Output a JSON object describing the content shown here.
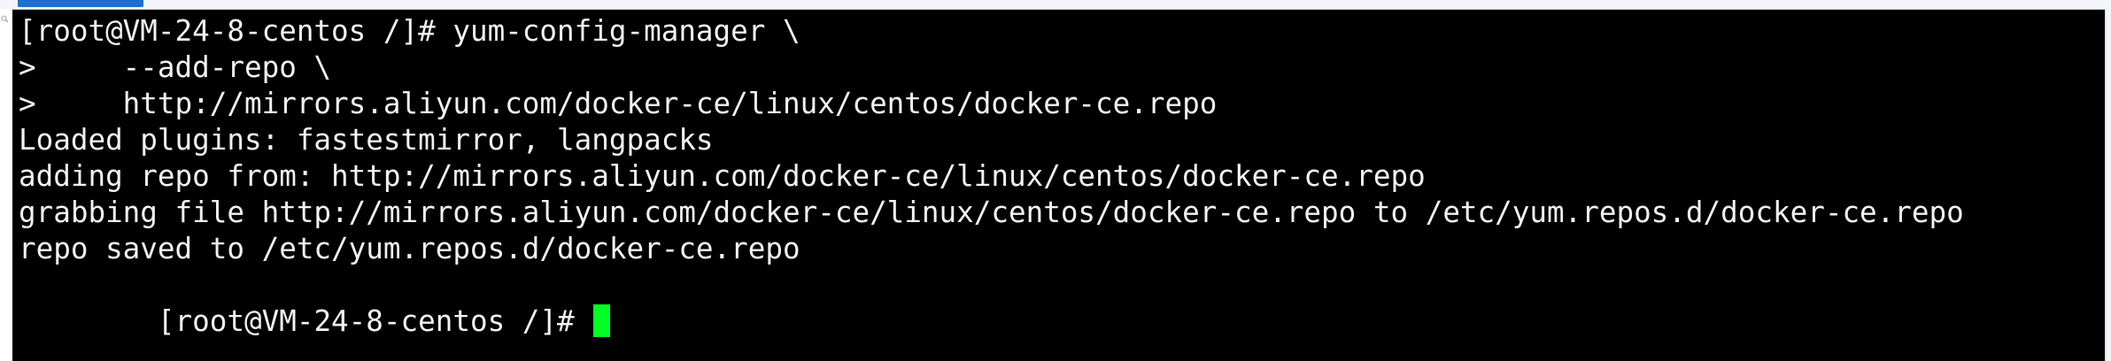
{
  "terminal": {
    "prompt_line": "[root@VM-24-8-centos /]# yum-config-manager \\",
    "lines": [
      ">     --add-repo \\",
      ">     http://mirrors.aliyun.com/docker-ce/linux/centos/docker-ce.repo",
      "Loaded plugins: fastestmirror, langpacks",
      "adding repo from: http://mirrors.aliyun.com/docker-ce/linux/centos/docker-ce.repo",
      "grabbing file http://mirrors.aliyun.com/docker-ce/linux/centos/docker-ce.repo to /etc/yum.repos.d/docker-ce.repo",
      "repo saved to /etc/yum.repos.d/docker-ce.repo"
    ],
    "current_prompt": "[root@VM-24-8-centos /]# ",
    "cursor_color": "#00ff23"
  },
  "icons": {
    "left_rail": "search-icon"
  },
  "colors": {
    "background": "#000000",
    "text": "#f2f2f2",
    "tab_accent": "#1f6fd2"
  }
}
